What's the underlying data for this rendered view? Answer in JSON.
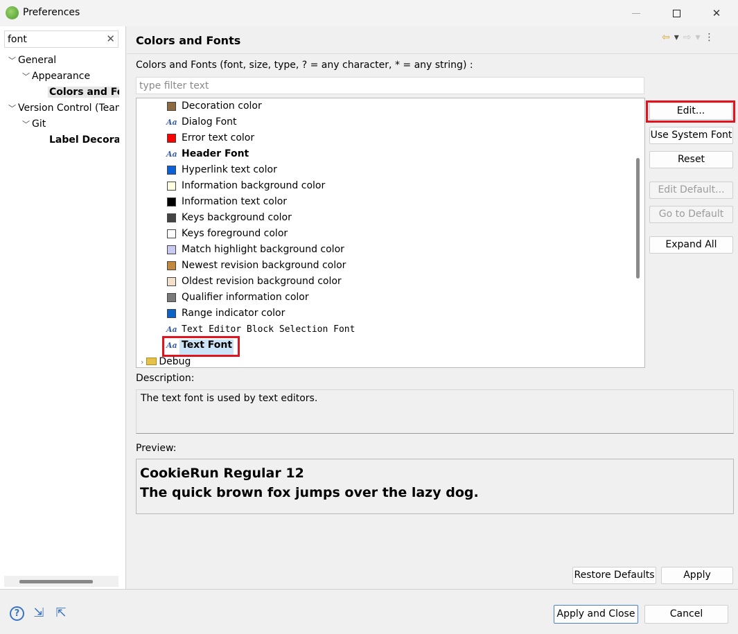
{
  "window": {
    "title": "Preferences"
  },
  "left": {
    "search_value": "font",
    "tree": [
      {
        "label": "General",
        "expanded": true
      },
      {
        "label": "Appearance",
        "expanded": true
      },
      {
        "label": "Colors and Fonts",
        "selected": true
      },
      {
        "label": "Version Control (Team)",
        "expanded": true
      },
      {
        "label": "Git",
        "expanded": true
      },
      {
        "label": "Label Decorations"
      }
    ]
  },
  "page": {
    "title": "Colors and Fonts",
    "subtitle": "Colors and Fonts (font, size, type, ? = any character, * = any string) :",
    "filter_placeholder": "type filter text"
  },
  "items": [
    {
      "label": "Decoration color",
      "kind": "color",
      "color": "#8b6b3f"
    },
    {
      "label": "Dialog Font",
      "kind": "font"
    },
    {
      "label": "Error text color",
      "kind": "color",
      "color": "#ff0000"
    },
    {
      "label": "Header Font",
      "kind": "font",
      "bold": true
    },
    {
      "label": "Hyperlink text color",
      "kind": "color",
      "color": "#0b5fd8"
    },
    {
      "label": "Information background color",
      "kind": "color",
      "color": "#ffffe1"
    },
    {
      "label": "Information text color",
      "kind": "color",
      "color": "#000000"
    },
    {
      "label": "Keys background color",
      "kind": "color",
      "color": "#444444"
    },
    {
      "label": "Keys foreground color",
      "kind": "color",
      "color": "#ffffff"
    },
    {
      "label": "Match highlight background color",
      "kind": "color",
      "color": "#c9c9f2"
    },
    {
      "label": "Newest revision background color",
      "kind": "color",
      "color": "#c3873d"
    },
    {
      "label": "Oldest revision background color",
      "kind": "color",
      "color": "#f2e0cc"
    },
    {
      "label": "Qualifier information color",
      "kind": "color",
      "color": "#7a7a7a"
    },
    {
      "label": "Range indicator color",
      "kind": "color",
      "color": "#0a63c8"
    },
    {
      "label": "Text Editor Block Selection Font",
      "kind": "font",
      "mono": true
    },
    {
      "label": "Text Font",
      "kind": "font",
      "bold": true,
      "selected": true
    }
  ],
  "debug_label": "Debug",
  "buttons": {
    "edit": "Edit...",
    "use_system_font": "Use System Font",
    "reset": "Reset",
    "edit_default": "Edit Default...",
    "go_to_default": "Go to Default",
    "expand_all": "Expand All",
    "restore_defaults": "Restore Defaults",
    "apply": "Apply",
    "apply_and_close": "Apply and Close",
    "cancel": "Cancel"
  },
  "description": {
    "label": "Description:",
    "text": "The text font is used by text editors."
  },
  "preview": {
    "label": "Preview:",
    "line1": "CookieRun Regular 12",
    "line2": "The quick brown fox jumps over the lazy dog."
  },
  "icons": {
    "help": "help-icon",
    "import": "import-icon",
    "export": "export-icon",
    "back": "back-arrow-icon",
    "forward": "forward-arrow-icon"
  }
}
